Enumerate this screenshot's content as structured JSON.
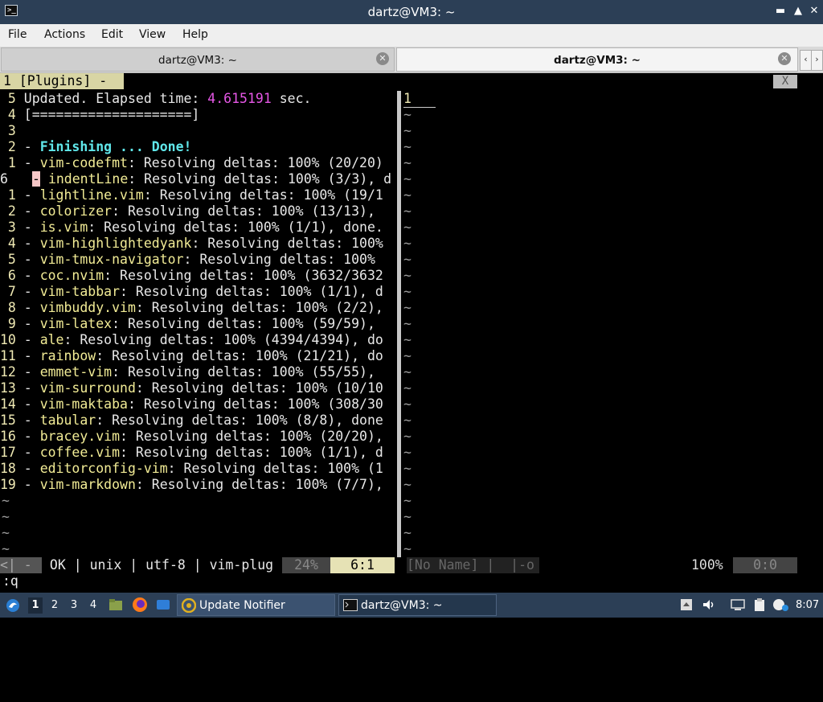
{
  "window": {
    "title": "dartz@VM3: ~",
    "app_icon": ">_",
    "buttons": [
      "minimize",
      "maximize",
      "close"
    ]
  },
  "menu": [
    "File",
    "Actions",
    "Edit",
    "View",
    "Help"
  ],
  "tabs": [
    {
      "label": "dartz@VM3: ~",
      "active": false
    },
    {
      "label": "dartz@VM3: ~",
      "active": true
    }
  ],
  "vim": {
    "buffer_tab": "1 [Plugins] -",
    "close_tab": "X",
    "lines": [
      {
        "num": " 5",
        "sep": "",
        "pre": " Updated. Elapsed time: ",
        "plugin": "",
        "text": "",
        "highlight": "4.615191",
        "post": " sec."
      },
      {
        "num": " 4",
        "sep": "",
        "pre": " [====================]",
        "plugin": "",
        "text": "",
        "highlight": "",
        "post": ""
      },
      {
        "num": " 3",
        "sep": "",
        "pre": "",
        "plugin": "",
        "text": "",
        "highlight": "",
        "post": ""
      },
      {
        "num": " 2",
        "sep": " - ",
        "pre": "",
        "plugin": "",
        "text": "",
        "highlight": "",
        "post": "",
        "done": "Finishing ... Done!"
      },
      {
        "num": " 1",
        "sep": " - ",
        "plugin": "vim-codefmt",
        "text": ": Resolving deltas: 100% (20/20)"
      },
      {
        "num": "6 ",
        "sep": "-",
        "plugin": "indentLine",
        "text": ": Resolving deltas: 100% (3/3), d",
        "current": true
      },
      {
        "num": " 1",
        "sep": " - ",
        "plugin": "lightline.vim",
        "text": ": Resolving deltas: 100% (19/1"
      },
      {
        "num": " 2",
        "sep": " - ",
        "plugin": "colorizer",
        "text": ": Resolving deltas: 100% (13/13),"
      },
      {
        "num": " 3",
        "sep": " - ",
        "plugin": "is.vim",
        "text": ": Resolving deltas: 100% (1/1), done."
      },
      {
        "num": " 4",
        "sep": " - ",
        "plugin": "vim-highlightedyank",
        "text": ": Resolving deltas: 100%"
      },
      {
        "num": " 5",
        "sep": " - ",
        "plugin": "vim-tmux-navigator",
        "text": ": Resolving deltas: 100%"
      },
      {
        "num": " 6",
        "sep": " - ",
        "plugin": "coc.nvim",
        "text": ": Resolving deltas: 100% (3632/3632"
      },
      {
        "num": " 7",
        "sep": " - ",
        "plugin": "vim-tabbar",
        "text": ": Resolving deltas: 100% (1/1), d"
      },
      {
        "num": " 8",
        "sep": " - ",
        "plugin": "vimbuddy.vim",
        "text": ": Resolving deltas: 100% (2/2),"
      },
      {
        "num": " 9",
        "sep": " - ",
        "plugin": "vim-latex",
        "text": ": Resolving deltas: 100% (59/59),"
      },
      {
        "num": "10",
        "sep": " - ",
        "plugin": "ale",
        "text": ": Resolving deltas: 100% (4394/4394), do"
      },
      {
        "num": "11",
        "sep": " - ",
        "plugin": "rainbow",
        "text": ": Resolving deltas: 100% (21/21), do"
      },
      {
        "num": "12",
        "sep": " - ",
        "plugin": "emmet-vim",
        "text": ": Resolving deltas: 100% (55/55),"
      },
      {
        "num": "13",
        "sep": " - ",
        "plugin": "vim-surround",
        "text": ": Resolving deltas: 100% (10/10"
      },
      {
        "num": "14",
        "sep": " - ",
        "plugin": "vim-maktaba",
        "text": ": Resolving deltas: 100% (308/30"
      },
      {
        "num": "15",
        "sep": " - ",
        "plugin": "tabular",
        "text": ": Resolving deltas: 100% (8/8), done"
      },
      {
        "num": "16",
        "sep": " - ",
        "plugin": "bracey.vim",
        "text": ": Resolving deltas: 100% (20/20),"
      },
      {
        "num": "17",
        "sep": " - ",
        "plugin": "coffee.vim",
        "text": ": Resolving deltas: 100% (1/1), d"
      },
      {
        "num": "18",
        "sep": " - ",
        "plugin": "editorconfig-vim",
        "text": ": Resolving deltas: 100% (1"
      },
      {
        "num": "19",
        "sep": " - ",
        "plugin": "vim-markdown",
        "text": ": Resolving deltas: 100% (7/7),"
      }
    ],
    "empty_marker": "~",
    "right_first_line": "1",
    "status_left": {
      "mode": "<| - ",
      "info": " OK | unix | utf-8 | vim-plug ",
      "percent": "24%",
      "position": "6:1"
    },
    "status_right": {
      "name": "[No Name] |  |-o",
      "percent": "100%",
      "position": "0:0"
    },
    "cmdline": ":q"
  },
  "taskbar": {
    "workspaces": [
      "1",
      "2",
      "3",
      "4"
    ],
    "tasks": [
      {
        "label": "Update Notifier",
        "icon": "update-notifier-icon"
      },
      {
        "label": "dartz@VM3: ~",
        "icon": "terminal-icon"
      }
    ],
    "clock": "8:07"
  }
}
